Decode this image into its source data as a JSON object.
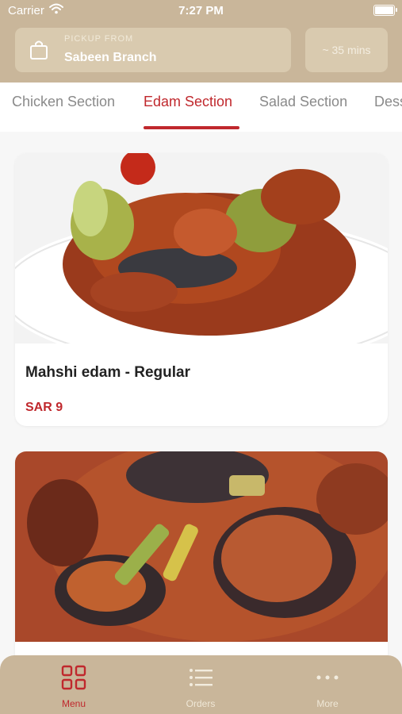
{
  "status_bar": {
    "carrier": "Carrier",
    "time": "7:27 PM"
  },
  "pickup": {
    "label": "PICKUP FROM",
    "branch": "Sabeen Branch"
  },
  "eta": "~ 35 mins",
  "tabs": [
    {
      "label": "Chicken Section",
      "active": false
    },
    {
      "label": "Edam Section",
      "active": true
    },
    {
      "label": "Salad Section",
      "active": false
    },
    {
      "label": "Dess",
      "active": false
    }
  ],
  "items": [
    {
      "name": "Mahshi edam - Regular",
      "price": "SAR 9",
      "image": "stuffed-vegetables-photo"
    },
    {
      "name": "",
      "price": "",
      "image": "eggplant-stew-photo"
    }
  ],
  "nav": [
    {
      "label": "Menu",
      "icon": "grid-icon",
      "active": true
    },
    {
      "label": "Orders",
      "icon": "list-icon",
      "active": false
    },
    {
      "label": "More",
      "icon": "more-icon",
      "active": false
    }
  ],
  "colors": {
    "accent": "#c0282d",
    "header": "#c9b69a",
    "chip": "#d9caaf"
  }
}
